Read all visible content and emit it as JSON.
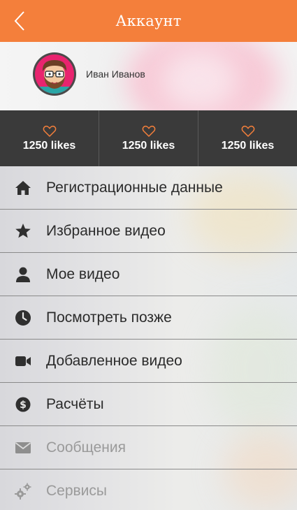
{
  "header": {
    "title": "Аккаунт",
    "back_icon": "chevron-left-icon"
  },
  "profile": {
    "name": "Иван Иванов",
    "avatar_icon": "avatar-bearded-man-icon"
  },
  "stats": [
    {
      "icon": "heart-outline-icon",
      "value": "1250 likes"
    },
    {
      "icon": "heart-outline-icon",
      "value": "1250 likes"
    },
    {
      "icon": "heart-outline-icon",
      "value": "1250 likes"
    }
  ],
  "menu": [
    {
      "icon": "home-icon",
      "label": "Регистрационные данные",
      "enabled": true
    },
    {
      "icon": "star-icon",
      "label": "Избранное видео",
      "enabled": true
    },
    {
      "icon": "user-icon",
      "label": "Мое видео",
      "enabled": true
    },
    {
      "icon": "clock-icon",
      "label": "Посмотреть позже",
      "enabled": true
    },
    {
      "icon": "video-camera-icon",
      "label": "Добавленное видео",
      "enabled": true
    },
    {
      "icon": "dollar-coin-icon",
      "label": "Расчёты",
      "enabled": true
    },
    {
      "icon": "envelope-icon",
      "label": "Сообщения",
      "enabled": false
    },
    {
      "icon": "gears-icon",
      "label": "Сервисы",
      "enabled": false
    }
  ],
  "colors": {
    "accent": "#f47f3b",
    "stats_background": "#3a3a3a",
    "heart": "#f47f3b",
    "menu_text": "#2b2b2b",
    "menu_text_disabled": "#9a9a9a"
  }
}
